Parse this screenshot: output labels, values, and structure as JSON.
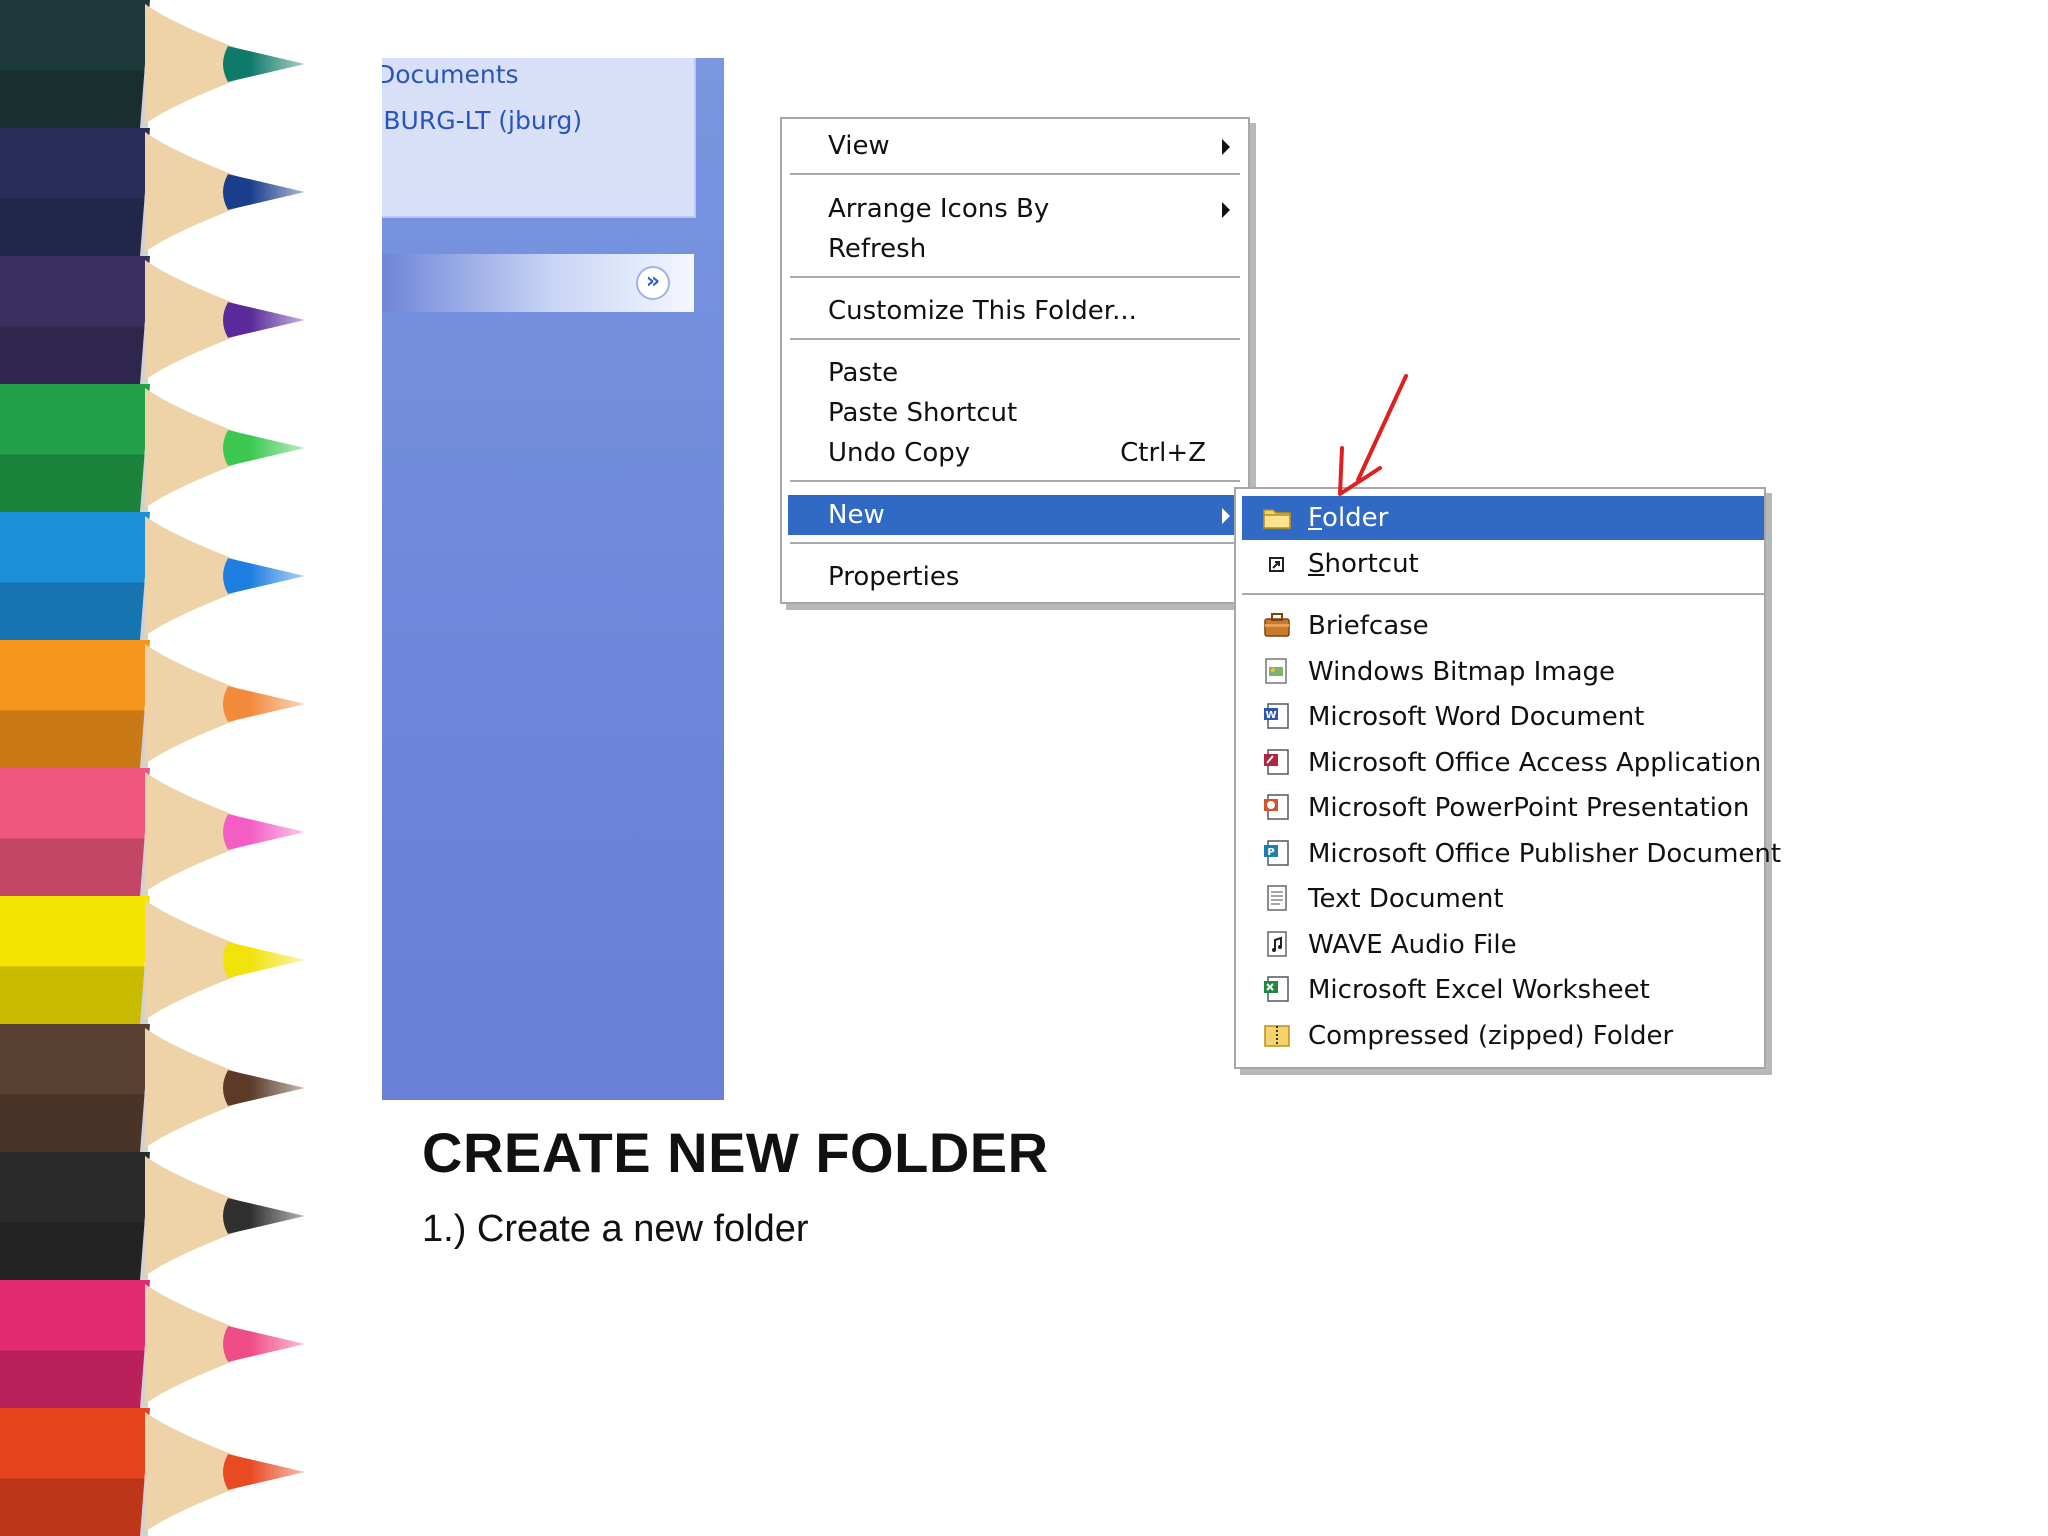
{
  "task_pane": {
    "links": [
      "Documents",
      "JBURG-LT (jburg)"
    ],
    "toggle_icon": "chevron-double-down-icon"
  },
  "context_menu": {
    "items": [
      {
        "label": "View",
        "has_submenu": true
      },
      {
        "label": "Arrange Icons By",
        "has_submenu": true
      },
      {
        "label": "Refresh"
      },
      {
        "label": "Customize This Folder..."
      },
      {
        "label": "Paste"
      },
      {
        "label": "Paste Shortcut"
      },
      {
        "label": "Undo Copy",
        "shortcut": "Ctrl+Z"
      },
      {
        "label": "New",
        "has_submenu": true,
        "selected": true
      },
      {
        "label": "Properties"
      }
    ]
  },
  "new_submenu": {
    "items": [
      {
        "label": "Folder",
        "icon": "folder-icon",
        "selected": true
      },
      {
        "label": "Shortcut",
        "icon": "shortcut-icon"
      },
      {
        "label": "Briefcase",
        "icon": "briefcase-icon"
      },
      {
        "label": "Windows Bitmap Image",
        "icon": "bitmap-icon"
      },
      {
        "label": "Microsoft Word Document",
        "icon": "word-icon"
      },
      {
        "label": "Microsoft Office Access Application",
        "icon": "access-icon"
      },
      {
        "label": "Microsoft PowerPoint Presentation",
        "icon": "powerpoint-icon"
      },
      {
        "label": "Microsoft Office Publisher Document",
        "icon": "publisher-icon"
      },
      {
        "label": "Text Document",
        "icon": "text-document-icon"
      },
      {
        "label": "WAVE Audio File",
        "icon": "audio-file-icon"
      },
      {
        "label": "Microsoft Excel Worksheet",
        "icon": "excel-icon"
      },
      {
        "label": "Compressed (zipped) Folder",
        "icon": "zip-folder-icon"
      }
    ]
  },
  "slide": {
    "title": "CREATE NEW FOLDER",
    "bullet": "1.) Create a new folder"
  },
  "colors": {
    "menu_highlight": "#316ac5",
    "task_pane": "#7a96e0",
    "annotation_arrow": "#e02020"
  }
}
